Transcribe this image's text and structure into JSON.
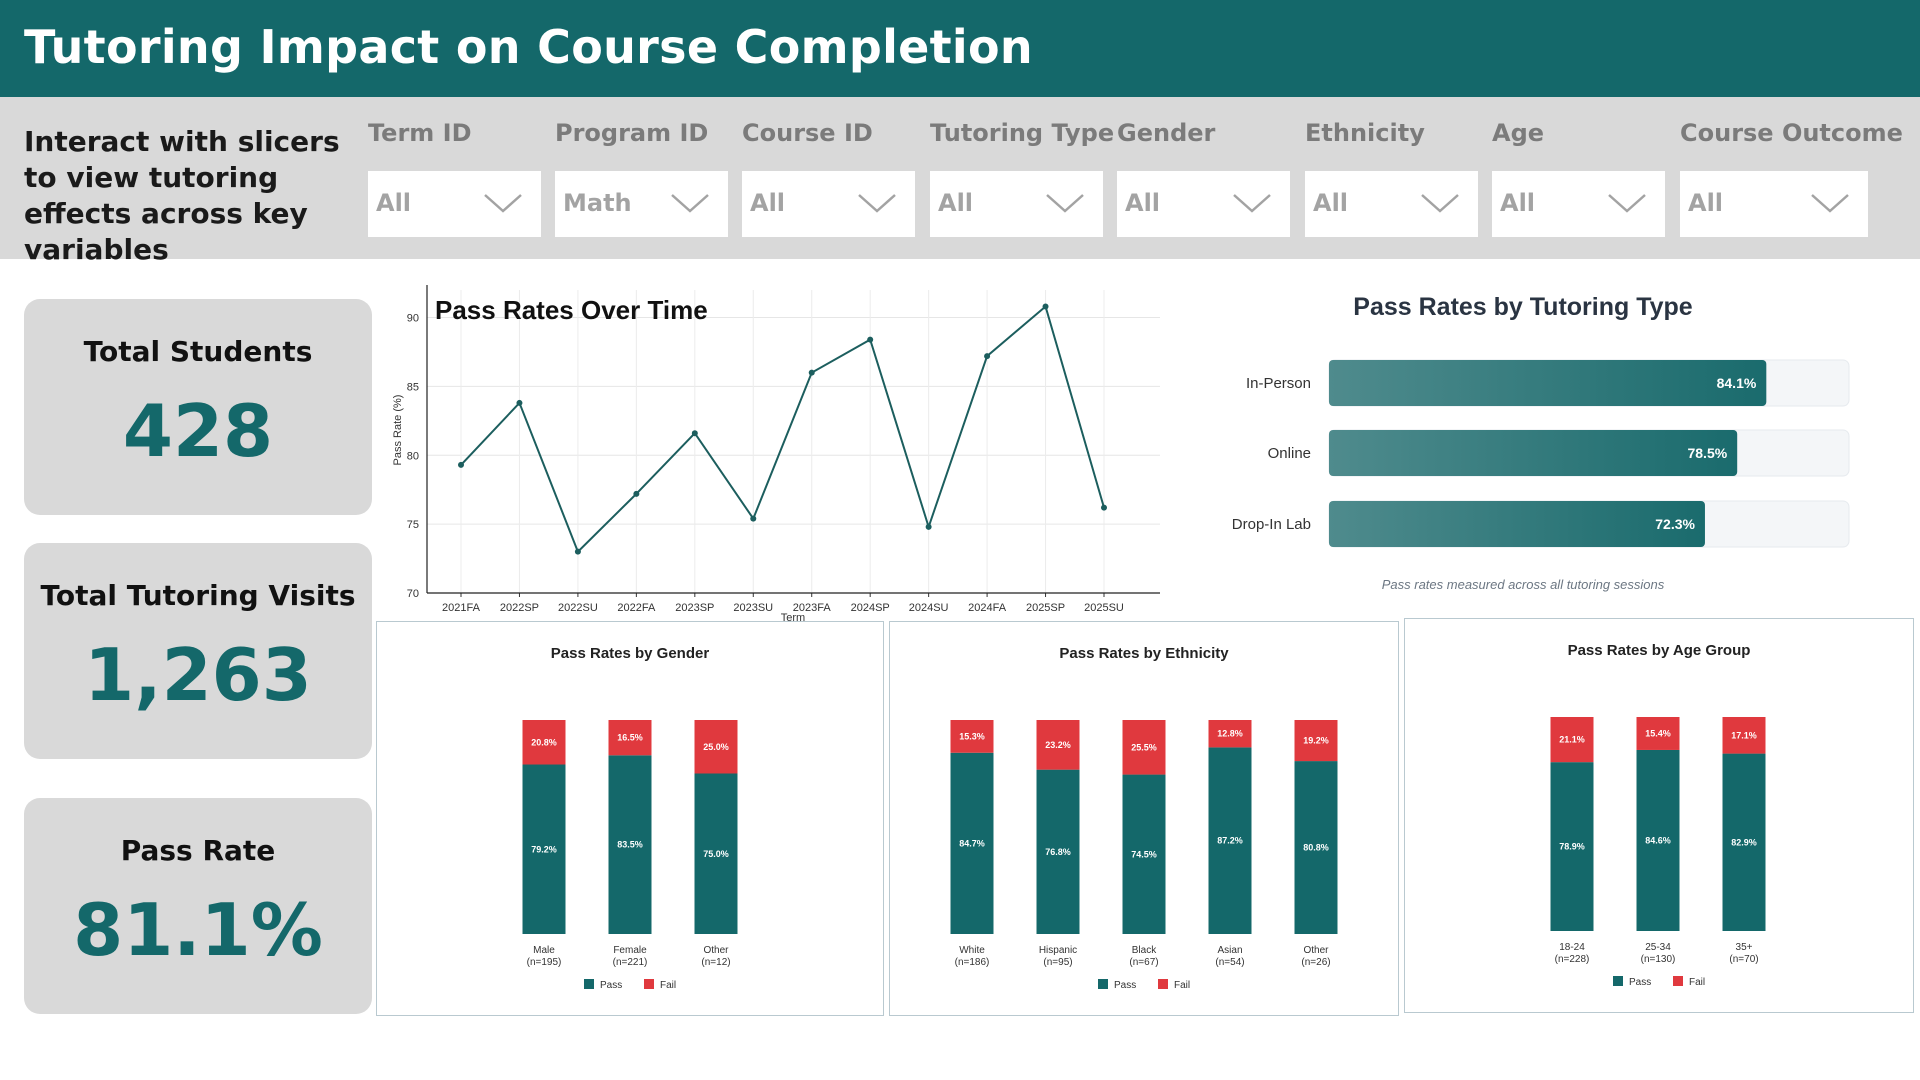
{
  "header": {
    "title": "Tutoring Impact on Course Completion"
  },
  "slicers": {
    "intro": "Interact with slicers to view tutoring effects across key variables",
    "items": [
      {
        "label": "Term ID",
        "value": "All"
      },
      {
        "label": "Program ID",
        "value": "Math"
      },
      {
        "label": "Course ID",
        "value": "All"
      },
      {
        "label": "Tutoring Type",
        "value": "All"
      },
      {
        "label": "Gender",
        "value": "All"
      },
      {
        "label": "Ethnicity",
        "value": "All"
      },
      {
        "label": "Age",
        "value": "All"
      },
      {
        "label": "Course Outcome",
        "value": "All"
      }
    ]
  },
  "kpis": [
    {
      "label": "Total Students",
      "value": "428"
    },
    {
      "label": "Total Tutoring Visits",
      "value": "1,263"
    },
    {
      "label": "Pass Rate",
      "value": "81.1%"
    }
  ],
  "colors": {
    "teal": "#14686a",
    "fail": "#e0393e",
    "slicer_bg": "#d9d9d9",
    "line": "#1c5e5e"
  },
  "chart_data": [
    {
      "type": "line",
      "title": "Pass Rates Over Time",
      "xlabel": "Term",
      "ylabel": "Pass Rate (%)",
      "x": [
        "2021FA",
        "2022SP",
        "2022SU",
        "2022FA",
        "2023SP",
        "2023SU",
        "2023FA",
        "2024SP",
        "2024SU",
        "2024FA",
        "2025SP",
        "2025SU"
      ],
      "values": [
        79.3,
        83.8,
        73.0,
        77.2,
        81.6,
        75.4,
        86.0,
        88.4,
        74.8,
        87.2,
        90.8,
        76.2
      ],
      "ylim": [
        70,
        92
      ],
      "yticks": [
        70,
        75,
        80,
        85,
        90
      ],
      "grid": true
    },
    {
      "type": "bar",
      "orientation": "horizontal",
      "title": "Pass Rates by Tutoring Type",
      "categories": [
        "In-Person",
        "Online",
        "Drop-In Lab"
      ],
      "values": [
        84.1,
        78.5,
        72.3
      ],
      "labels": [
        "84.1%",
        "78.5%",
        "72.3%"
      ],
      "xlim": [
        0,
        100
      ],
      "note": "Pass rates measured across all tutoring sessions"
    },
    {
      "type": "bar",
      "stacked": true,
      "title": "Pass Rates by Gender",
      "categories": [
        "Male",
        "Female",
        "Other"
      ],
      "counts": [
        "(n=195)",
        "(n=221)",
        "(n=12)"
      ],
      "series": [
        {
          "name": "Pass",
          "values": [
            79.2,
            83.5,
            75.0
          ],
          "labels": [
            "79.2%",
            "83.5%",
            "75.0%"
          ]
        },
        {
          "name": "Fail",
          "values": [
            20.8,
            16.5,
            25.0
          ],
          "labels": [
            "20.8%",
            "16.5%",
            "25.0%"
          ]
        }
      ],
      "ylim": [
        0,
        100
      ],
      "legend": "bottom"
    },
    {
      "type": "bar",
      "stacked": true,
      "title": "Pass Rates by Ethnicity",
      "categories": [
        "White",
        "Hispanic",
        "Black",
        "Asian",
        "Other"
      ],
      "counts": [
        "(n=186)",
        "(n=95)",
        "(n=67)",
        "(n=54)",
        "(n=26)"
      ],
      "series": [
        {
          "name": "Pass",
          "values": [
            84.7,
            76.8,
            74.5,
            87.2,
            80.8
          ],
          "labels": [
            "84.7%",
            "76.8%",
            "74.5%",
            "87.2%",
            "80.8%"
          ]
        },
        {
          "name": "Fail",
          "values": [
            15.3,
            23.2,
            25.5,
            12.8,
            19.2
          ],
          "labels": [
            "15.3%",
            "23.2%",
            "25.5%",
            "12.8%",
            "19.2%"
          ]
        }
      ],
      "ylim": [
        0,
        100
      ],
      "legend": "bottom"
    },
    {
      "type": "bar",
      "stacked": true,
      "title": "Pass Rates by Age Group",
      "categories": [
        "18-24",
        "25-34",
        "35+"
      ],
      "counts": [
        "(n=228)",
        "(n=130)",
        "(n=70)"
      ],
      "series": [
        {
          "name": "Pass",
          "values": [
            78.9,
            84.6,
            82.9
          ],
          "labels": [
            "78.9%",
            "84.6%",
            "82.9%"
          ]
        },
        {
          "name": "Fail",
          "values": [
            21.1,
            15.4,
            17.1
          ],
          "labels": [
            "21.1%",
            "15.4%",
            "17.1%"
          ]
        }
      ],
      "ylim": [
        0,
        100
      ],
      "legend": "bottom"
    }
  ]
}
